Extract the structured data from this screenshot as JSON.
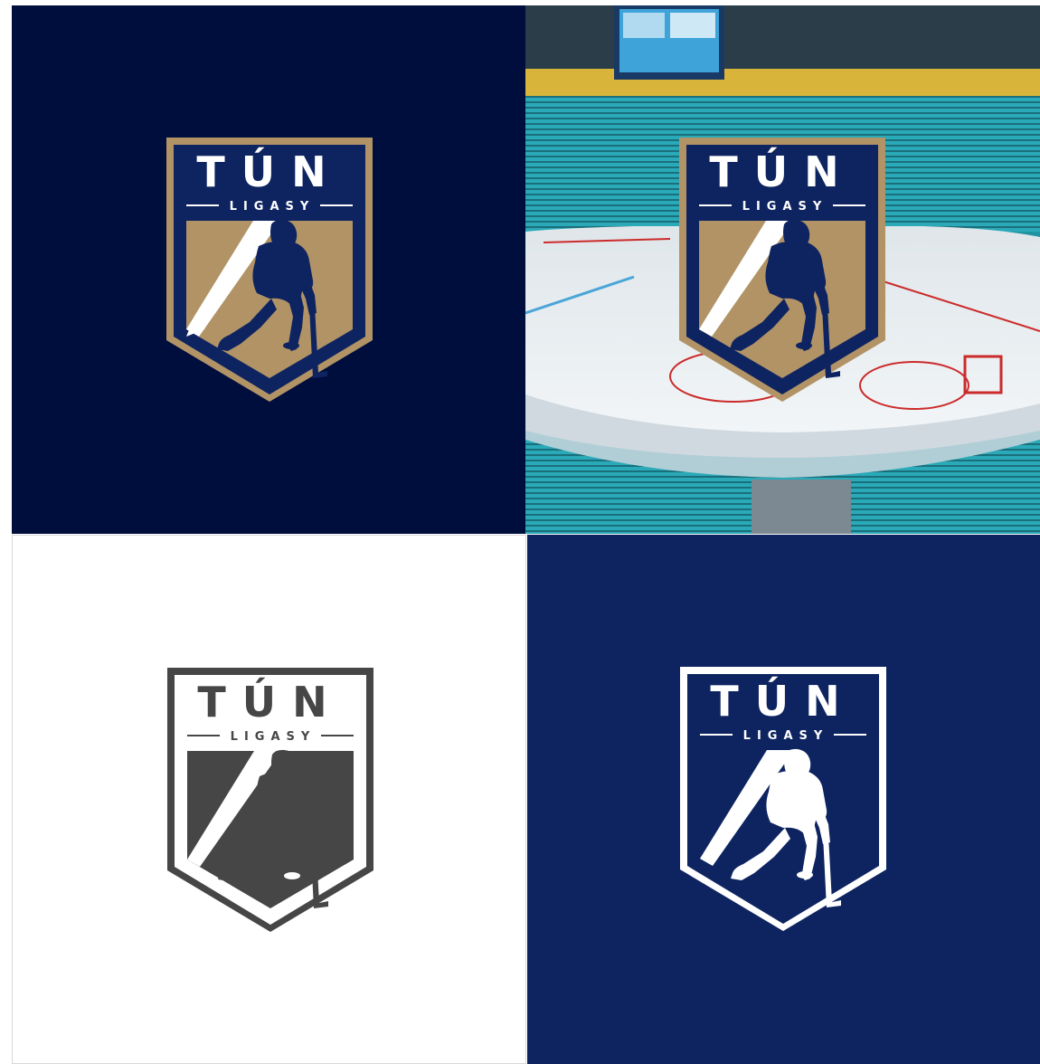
{
  "logo": {
    "title": "TÚN",
    "subtitle": "LIGASY"
  },
  "variants": [
    {
      "name": "gold-on-navy",
      "background": "#000e3d",
      "frame": "#b19366",
      "header": "#0e2461",
      "field_gold": "#b19366",
      "stripe": "#ffffff",
      "player": "#0e2461",
      "text": "#ffffff"
    },
    {
      "name": "gold-on-arena",
      "background": "arena-photo",
      "frame": "#b19366",
      "header": "#0e2461",
      "field_gold": "#b19366",
      "stripe": "#ffffff",
      "player": "#0e2461",
      "text": "#ffffff"
    },
    {
      "name": "grey-on-white",
      "background": "#ffffff",
      "frame": "#464646",
      "header": "#ffffff",
      "field_gold": "#464646",
      "stripe": "#ffffff",
      "player": "#464646",
      "text": "#464646"
    },
    {
      "name": "white-on-navy",
      "background": "#0e2461",
      "frame": "#ffffff",
      "header": "#0e2461",
      "field_gold": "#0e2461",
      "stripe": "#ffffff",
      "player": "#0e2461",
      "text": "#ffffff"
    }
  ],
  "colors": {
    "navy_dark": "#000e3d",
    "navy": "#0e2461",
    "gold": "#b19366",
    "grey": "#464646",
    "ice": "#eef2f5",
    "seat_teal": "#2fb6c4"
  },
  "icons": [
    "hockey-player-icon",
    "puck-icon",
    "hockey-stick-icon"
  ]
}
